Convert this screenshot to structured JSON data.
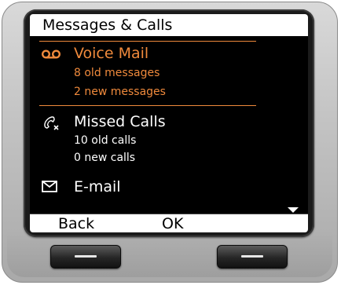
{
  "screen": {
    "title": "Messages & Calls"
  },
  "items": {
    "voicemail": {
      "title": "Voice Mail",
      "sub1": "8 old messages",
      "sub2": "2 new messages",
      "icon": "voicemail-icon"
    },
    "missed": {
      "title": "Missed Calls",
      "sub1": "10 old calls",
      "sub2": "0 new calls",
      "icon": "missed-call-icon"
    },
    "email": {
      "title": "E-mail",
      "icon": "envelope-icon"
    }
  },
  "softkeys": {
    "left": "Back",
    "right": "OK"
  },
  "colors": {
    "accent": "#f08a3c",
    "screen_bg": "#000000",
    "bar_bg": "#ffffff"
  }
}
